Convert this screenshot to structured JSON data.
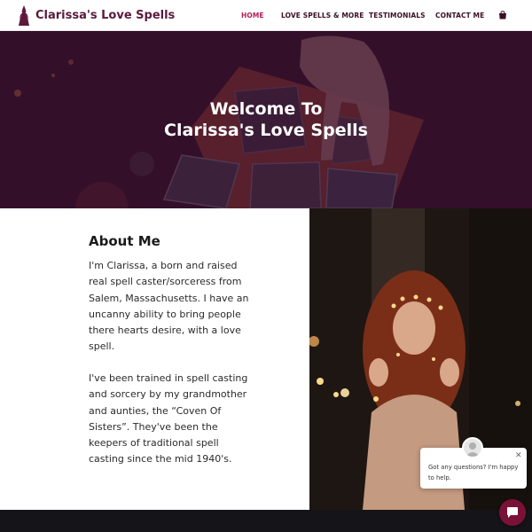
{
  "header": {
    "brand_name": "Clarissa's Love Spells",
    "brand_icon": "witch-silhouette-icon",
    "nav": [
      {
        "label": "HOME",
        "active": true
      },
      {
        "label": "LOVE SPELLS & MORE",
        "active": false
      },
      {
        "label": "TESTIMONIALS",
        "active": false
      },
      {
        "label": "CONTACT ME",
        "active": false
      }
    ],
    "cart_icon": "shopping-bag-icon"
  },
  "hero": {
    "title_line1": "Welcome To",
    "title_line2": "Clarissa's Love Spells"
  },
  "about": {
    "heading": "About Me",
    "paragraph1": "I'm Clarissa, a born and raised real spell caster/sorceress from Salem, Massachusetts. I have an uncanny ability to bring people there hearts desire, with a love spell.",
    "paragraph2": "I've been trained in spell casting and sorcery by my grandmother and aunties, the “Coven Of Sisters”. They've been the keepers of traditional spell casting since the mid 1940's."
  },
  "chat": {
    "message": "Got any questions? I'm happy to help.",
    "close_icon": "close-icon",
    "launcher_icon": "chat-icon"
  },
  "colors": {
    "brand": "#5a1a3c",
    "nav_active": "#b51d5a",
    "hero_overlay": "#3a1030",
    "launcher": "#7a1238"
  }
}
